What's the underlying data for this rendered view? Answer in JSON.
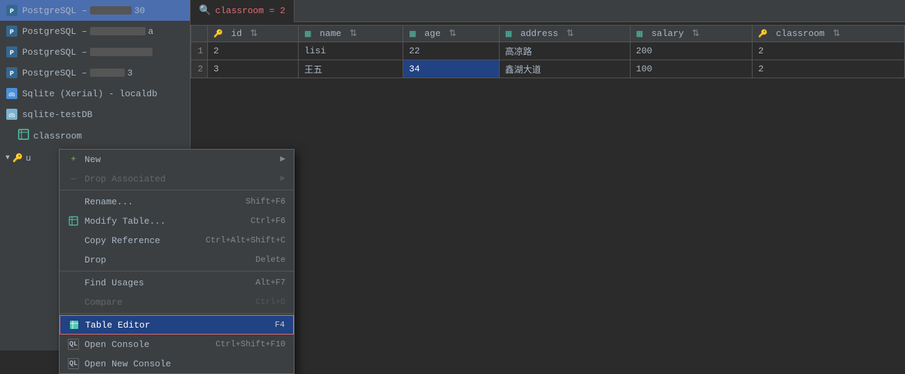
{
  "sidebar": {
    "items": [
      {
        "id": "pg1",
        "type": "postgresql",
        "label": "PostgreSQL",
        "blur": "80px",
        "extra": "30"
      },
      {
        "id": "pg2",
        "type": "postgresql",
        "label": "PostgreSQL",
        "blur": "100px",
        "extra": "a"
      },
      {
        "id": "pg3",
        "type": "postgresql",
        "label": "PostgreSQL",
        "blur": "90px",
        "extra": ""
      },
      {
        "id": "pg4",
        "type": "postgresql",
        "label": "PostgreSQL",
        "blur": "75px",
        "extra": "3"
      },
      {
        "id": "sqlite1",
        "type": "sqlite",
        "label": "Sqlite (Xerial) - localdb"
      },
      {
        "id": "sqlite2",
        "type": "sqlite2",
        "label": "sqlite-testDB"
      }
    ],
    "classroom_label": "classroom",
    "user_label": "u"
  },
  "tab": {
    "search_icon": "🔍",
    "label": "classroom = 2"
  },
  "table": {
    "columns": [
      {
        "name": "id",
        "type": "key"
      },
      {
        "name": "name",
        "type": "col"
      },
      {
        "name": "age",
        "type": "col"
      },
      {
        "name": "address",
        "type": "col"
      },
      {
        "name": "salary",
        "type": "col"
      },
      {
        "name": "classroom",
        "type": "key"
      }
    ],
    "rows": [
      {
        "rn": "1",
        "id": "2",
        "name": "lisi",
        "age": "22",
        "address": "高凉路",
        "salary": "200",
        "classroom": "2",
        "selected_col": ""
      },
      {
        "rn": "2",
        "id": "3",
        "name": "王五",
        "age": "34",
        "address": "鑫湖大道",
        "salary": "100",
        "classroom": "2",
        "selected_col": "age"
      }
    ]
  },
  "context_menu": {
    "items": [
      {
        "id": "new",
        "label": "New",
        "shortcut": "",
        "icon": "new",
        "has_arrow": true,
        "disabled": false
      },
      {
        "id": "drop-associated",
        "label": "Drop Associated",
        "shortcut": "",
        "icon": "dash",
        "has_arrow": true,
        "disabled": true
      },
      {
        "id": "rename",
        "label": "Rename...",
        "shortcut": "Shift+F6",
        "icon": "",
        "disabled": false
      },
      {
        "id": "modify-table",
        "label": "Modify Table...",
        "shortcut": "Ctrl+F6",
        "icon": "table",
        "disabled": false
      },
      {
        "id": "copy-reference",
        "label": "Copy Reference",
        "shortcut": "Ctrl+Alt+Shift+C",
        "icon": "",
        "disabled": false
      },
      {
        "id": "drop",
        "label": "Drop",
        "shortcut": "Delete",
        "icon": "",
        "disabled": false
      },
      {
        "id": "find-usages",
        "label": "Find Usages",
        "shortcut": "Alt+F7",
        "icon": "",
        "disabled": false
      },
      {
        "id": "compare",
        "label": "Compare",
        "shortcut": "Ctrl+D",
        "icon": "",
        "disabled": true
      },
      {
        "id": "table-editor",
        "label": "Table Editor",
        "shortcut": "F4",
        "icon": "table2",
        "highlighted": true,
        "disabled": false
      },
      {
        "id": "open-console",
        "label": "Open Console",
        "shortcut": "Ctrl+Shift+F10",
        "icon": "ql",
        "disabled": false
      },
      {
        "id": "open-new-console",
        "label": "Open New Console",
        "shortcut": "",
        "icon": "ql2",
        "disabled": false
      }
    ]
  }
}
